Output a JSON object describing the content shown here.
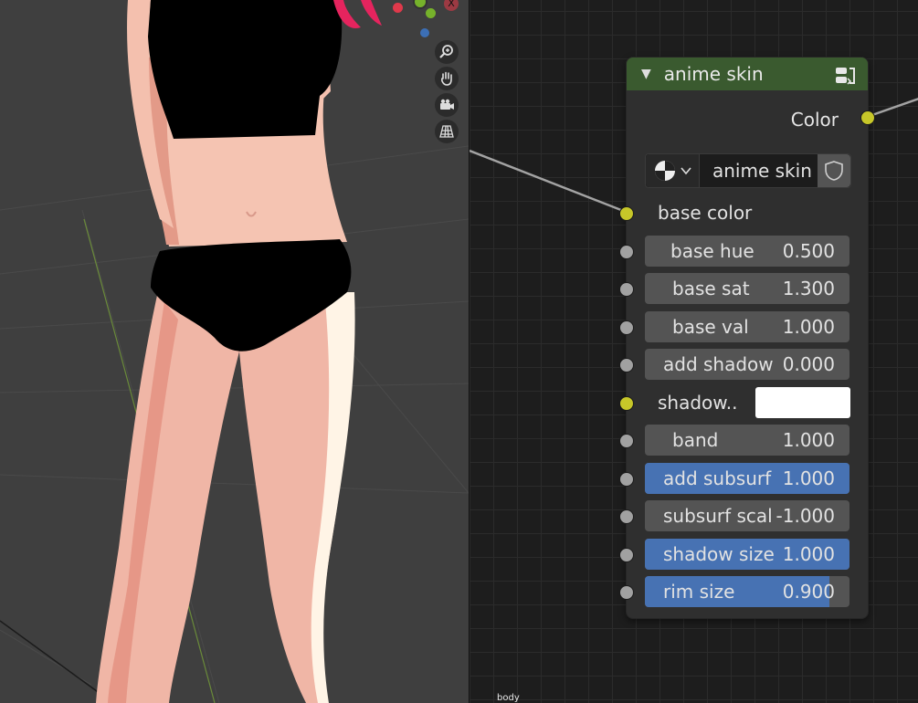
{
  "viewport": {
    "nav_icons": [
      "zoom-icon",
      "hand-pan-icon",
      "camera-icon",
      "grid-perspective-icon"
    ],
    "gizmo_axis_label": "X"
  },
  "node": {
    "title": "anime skin",
    "header_color": "#3a5a2f",
    "output_label": "Color",
    "group_selector": {
      "name": "anime skin"
    },
    "color_input_label": "base color",
    "fields": [
      {
        "label": "base hue",
        "value": "0.500",
        "fill": 0,
        "highlight": false
      },
      {
        "label": "base sat",
        "value": "1.300",
        "fill": 0,
        "highlight": false
      },
      {
        "label": "base val",
        "value": "1.000",
        "fill": 0,
        "highlight": false
      },
      {
        "label": "add shadow",
        "value": "0.000",
        "fill": 0,
        "highlight": false
      },
      {
        "label": "band",
        "value": "1.000",
        "fill": 0,
        "highlight": false
      },
      {
        "label": "add subsurf",
        "value": "1.000",
        "fill": 1,
        "highlight": true
      },
      {
        "label": "subsurf scal",
        "value": "-1.000",
        "fill": 0,
        "highlight": false
      },
      {
        "label": "shadow size",
        "value": "1.000",
        "fill": 1,
        "highlight": true
      },
      {
        "label": "rim size",
        "value": "0.900",
        "fill": 0.9,
        "highlight": true
      }
    ],
    "shadow_color_label": "shadow..",
    "shadow_color_value": "#ffffff"
  },
  "frame_label": "body"
}
